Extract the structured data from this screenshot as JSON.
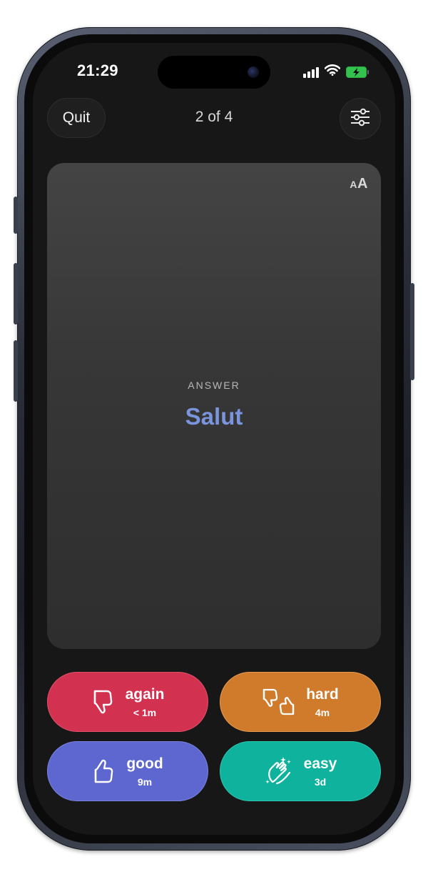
{
  "status_bar": {
    "time": "21:29"
  },
  "header": {
    "quit_label": "Quit",
    "progress": "2 of 4"
  },
  "card": {
    "font_size_small": "A",
    "font_size_large": "A",
    "section_label": "ANSWER",
    "answer": "Salut",
    "answer_color": "#7a95dd"
  },
  "ratings": [
    {
      "label": "again",
      "interval": "< 1m",
      "icon": "thumbs-down-icon",
      "color": "#d33150"
    },
    {
      "label": "hard",
      "interval": "4m",
      "icon": "mixed-thumbs-icon",
      "color": "#d07a2c"
    },
    {
      "label": "good",
      "interval": "9m",
      "icon": "thumbs-up-icon",
      "color": "#5e67cf"
    },
    {
      "label": "easy",
      "interval": "3d",
      "icon": "clapping-hands-icon",
      "color": "#0fb29c"
    }
  ],
  "colors": {
    "background": "#171717",
    "card": "#3a3a3a",
    "battery": "#33c24d"
  }
}
